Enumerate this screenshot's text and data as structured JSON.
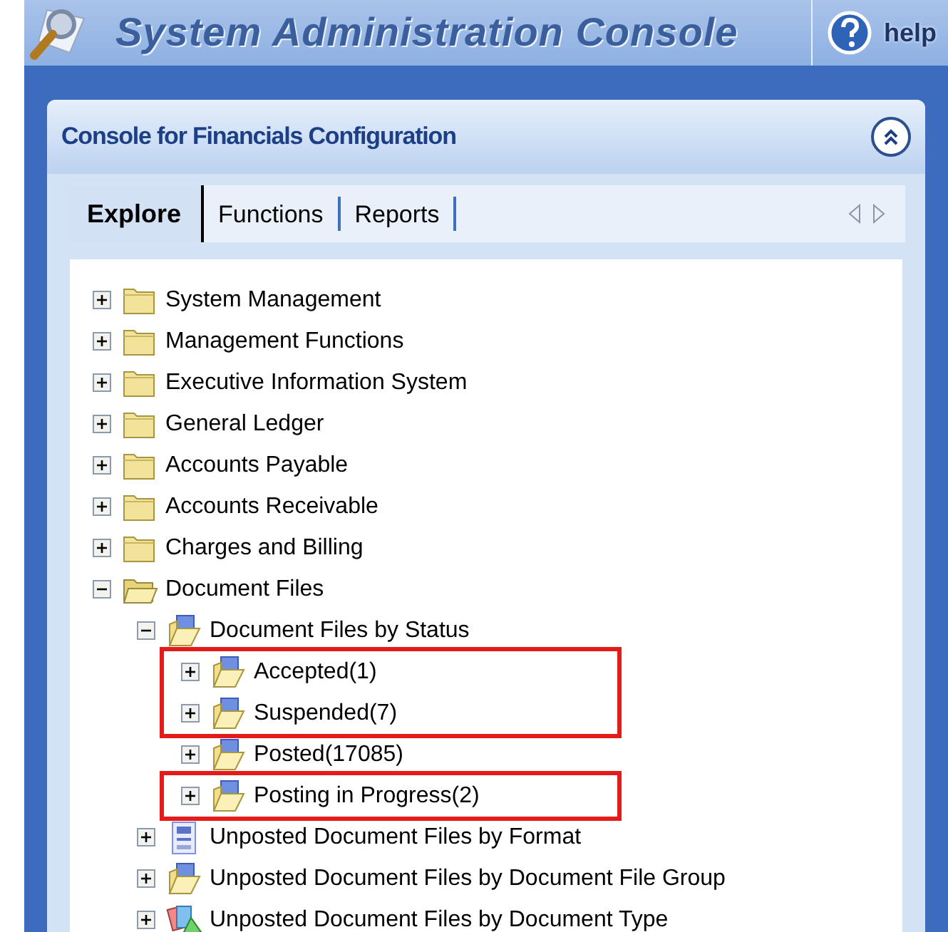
{
  "header": {
    "title": "System Administration Console",
    "help": "help"
  },
  "panel": {
    "title": "Console for Financials Configuration"
  },
  "tabs": [
    {
      "label": "Explore",
      "selected": true
    },
    {
      "label": "Functions",
      "selected": false
    },
    {
      "label": "Reports",
      "selected": false
    }
  ],
  "tree": [
    {
      "label": "System Management",
      "kind": "folder",
      "expanded": false
    },
    {
      "label": "Management Functions",
      "kind": "folder",
      "expanded": false
    },
    {
      "label": "Executive Information System",
      "kind": "folder",
      "expanded": false
    },
    {
      "label": "General Ledger",
      "kind": "folder",
      "expanded": false
    },
    {
      "label": "Accounts Payable",
      "kind": "folder",
      "expanded": false
    },
    {
      "label": "Accounts Receivable",
      "kind": "folder",
      "expanded": false
    },
    {
      "label": "Charges and Billing",
      "kind": "folder",
      "expanded": false
    },
    {
      "label": "Document Files",
      "kind": "folder",
      "expanded": true,
      "children": [
        {
          "label": "Document Files by Status",
          "kind": "status",
          "expanded": true,
          "children": [
            {
              "label": "Accepted(1)",
              "kind": "status",
              "expanded": false,
              "highlighted": true
            },
            {
              "label": "Suspended(7)",
              "kind": "status",
              "expanded": false,
              "highlighted": true
            },
            {
              "label": "Posted(17085)",
              "kind": "status",
              "expanded": false,
              "highlighted": false
            },
            {
              "label": "Posting in Progress(2)",
              "kind": "status",
              "expanded": false,
              "highlighted": true
            }
          ]
        },
        {
          "label": "Unposted Document Files by Format",
          "kind": "format",
          "expanded": false
        },
        {
          "label": "Unposted Document Files by Document File Group",
          "kind": "status",
          "expanded": false
        },
        {
          "label": "Unposted Document Files by Document Type",
          "kind": "type",
          "expanded": false
        }
      ]
    }
  ]
}
